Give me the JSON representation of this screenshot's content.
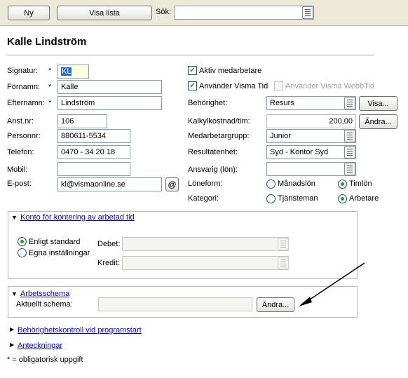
{
  "toolbar": {
    "new_label": "Ny",
    "show_list_label": "Visa lista",
    "search_label": "Sök:",
    "search_value": ""
  },
  "page_title": "Kalle Lindström",
  "left_fields": {
    "signatur": {
      "label": "Signatur:",
      "required": "*",
      "value": "KL"
    },
    "fornamn": {
      "label": "Förnamn:",
      "required": "*",
      "value": "Kalle"
    },
    "efternamn": {
      "label": "Efternamn:",
      "required": "*",
      "value": "Lindström"
    },
    "anstnr": {
      "label": "Anst.nr:",
      "value": "106"
    },
    "personnr": {
      "label": "Personnr:",
      "value": "880611-5534"
    },
    "telefon": {
      "label": "Telefon:",
      "value": "0470 - 34 20 18"
    },
    "mobil": {
      "label": "Mobil:",
      "value": ""
    },
    "epost": {
      "label": "E-post:",
      "value": "kl@vismaonline.se",
      "at_symbol": "@"
    }
  },
  "right_fields": {
    "aktiv": {
      "label": "Aktiv medarbetare",
      "checked": true
    },
    "visma_tid": {
      "label": "Använder Visma Tid",
      "checked": true
    },
    "webbtid": {
      "label": "Använder Visma WebbTid",
      "checked": false
    },
    "behorighet": {
      "label": "Behörighet:",
      "value": "Resurs",
      "button": "Visa..."
    },
    "kalkylkostnad": {
      "label": "Kalkylkostnad/tim:",
      "value": "200,00",
      "button": "Ändra..."
    },
    "medarbetargrupp": {
      "label": "Medarbetargrupp:",
      "value": "Junior"
    },
    "resultatenhet": {
      "label": "Resultatenhet:",
      "value": "Syd - Kontor Syd"
    },
    "ansvarig": {
      "label": "Ansvarig (lön):",
      "value": ""
    },
    "loneform": {
      "label": "Löneform:",
      "options": [
        "Månadslön",
        "Timlön"
      ],
      "selected": "Timlön"
    },
    "kategori": {
      "label": "Kategori:",
      "options": [
        "Tjänsteman",
        "Arbetare"
      ],
      "selected": "Arbetare"
    }
  },
  "kontering": {
    "title": "Konto för kontering av arbetad tid",
    "options": [
      "Enligt standard",
      "Egna inställningar"
    ],
    "selected": "Enligt standard",
    "debet_label": "Debet:",
    "kredit_label": "Kredit:"
  },
  "arbetsschema": {
    "title": "Arbetsschema",
    "current_label": "Aktuellt schema:",
    "current_value": "",
    "button": "Ändra..."
  },
  "collapsed_sections": {
    "behorighetskontroll": "Behörighetskontroll vid programstart",
    "anteckningar": "Anteckningar"
  },
  "footnote": "* = obligatorisk uppgift",
  "colors": {
    "toolbar_bg": "#ece9d8",
    "input_border": "#7f9db9",
    "check_green": "#21a121",
    "link_blue": "#0000cc",
    "selection_blue": "#316ac5"
  }
}
